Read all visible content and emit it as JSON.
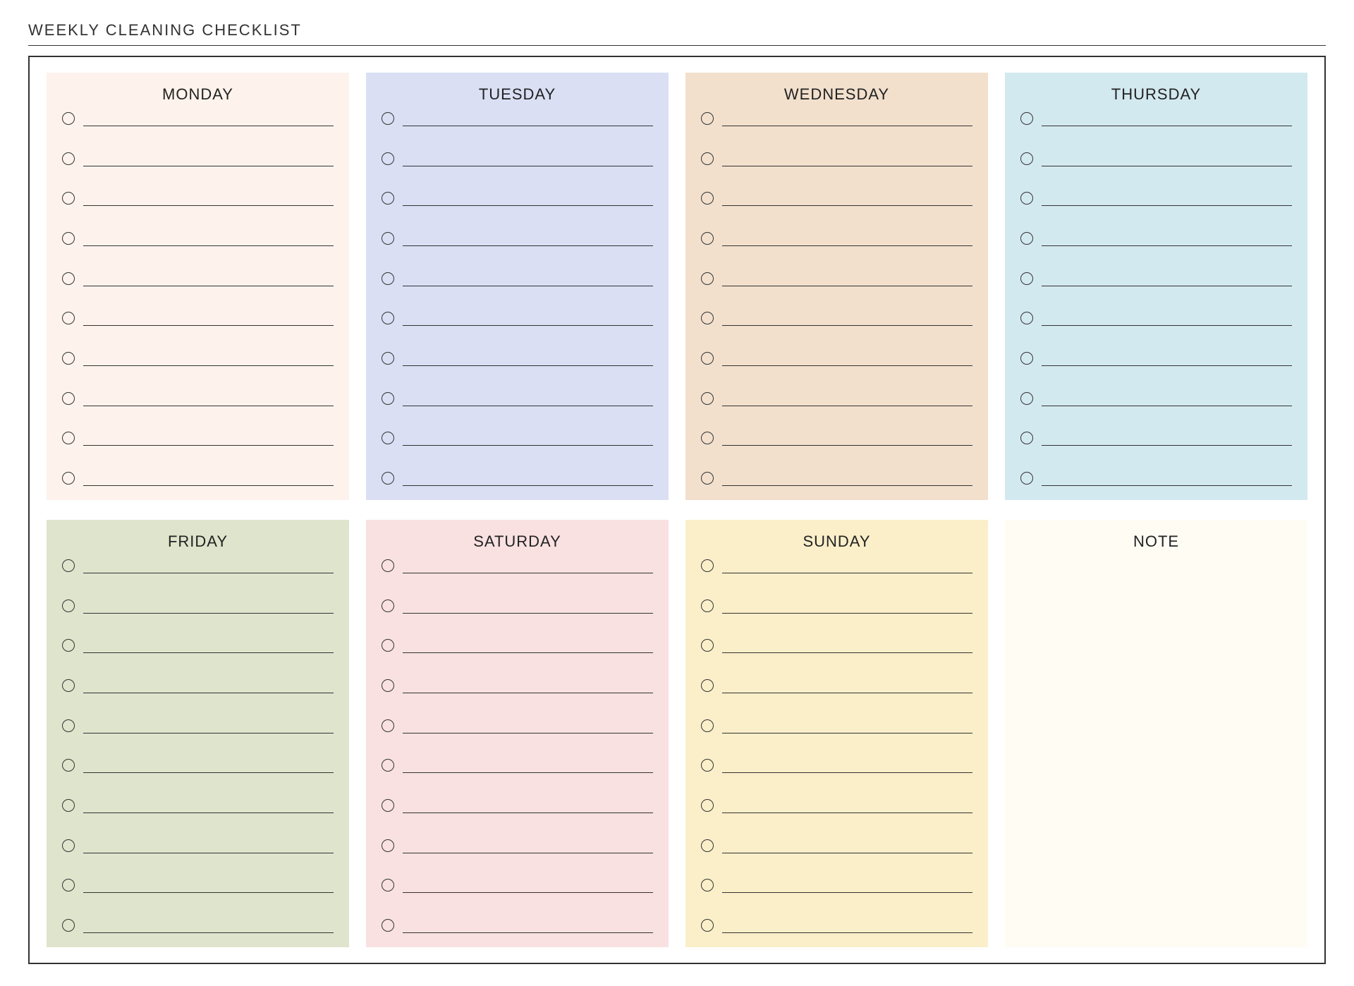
{
  "title": "WEEKLY CLEANING CHECKLIST",
  "lines_per_day": 10,
  "days": [
    {
      "key": "monday",
      "label": "MONDAY",
      "color": "#fdf3ec"
    },
    {
      "key": "tuesday",
      "label": "TUESDAY",
      "color": "#dadff4"
    },
    {
      "key": "wednesday",
      "label": "WEDNESDAY",
      "color": "#f2e0cd"
    },
    {
      "key": "thursday",
      "label": "THURSDAY",
      "color": "#d3e9f0"
    },
    {
      "key": "friday",
      "label": "FRIDAY",
      "color": "#dfe4cc"
    },
    {
      "key": "saturday",
      "label": "SATURDAY",
      "color": "#f9e1e1"
    },
    {
      "key": "sunday",
      "label": "SUNDAY",
      "color": "#faefc9"
    }
  ],
  "note": {
    "label": "NOTE",
    "color": "#fffcf4"
  }
}
